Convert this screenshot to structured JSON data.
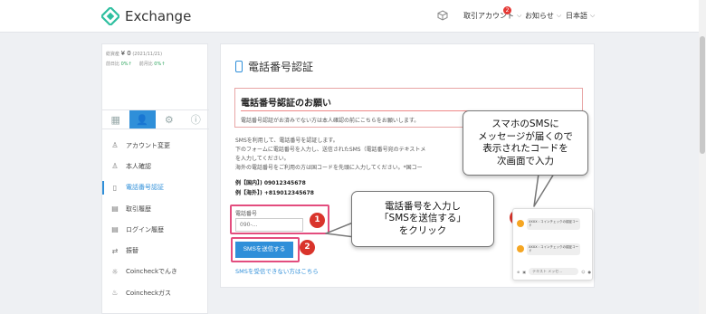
{
  "header": {
    "brand": "Exchange",
    "brand_color": "#2fbfa0",
    "nav": [
      {
        "label": "取引アカウント",
        "badge": "2"
      },
      {
        "label": "お知らせ"
      },
      {
        "label": "日本語"
      }
    ]
  },
  "sidebar": {
    "balance_label": "総資産",
    "balance_value": "¥ 0",
    "balance_date": "(2021/11/21)",
    "prev_day_label": "前日比",
    "prev_day_value": "0%↑",
    "prev_month_label": "前月比",
    "prev_month_value": "0%↑",
    "tabs": [
      {
        "icon": "grid-icon"
      },
      {
        "icon": "user-icon"
      },
      {
        "icon": "gear-icon"
      },
      {
        "icon": "help-icon"
      }
    ],
    "items": [
      {
        "label": "アカウント変更",
        "icon": "user-edit-icon"
      },
      {
        "label": "本人確認",
        "icon": "id-icon"
      },
      {
        "label": "電話番号認証",
        "icon": "phone-icon",
        "active": true
      },
      {
        "label": "取引履歴",
        "icon": "history-icon"
      },
      {
        "label": "ログイン履歴",
        "icon": "login-history-icon"
      },
      {
        "label": "振替",
        "icon": "transfer-icon"
      },
      {
        "label": "Coincheckでんき",
        "icon": "bulb-icon"
      },
      {
        "label": "Coincheckガス",
        "icon": "gas-icon"
      }
    ]
  },
  "main": {
    "title": "電話番号認証",
    "notice_title": "電話番号認証のお願い",
    "notice_text": "電話番号認証がお済みでない方は本人確認の前にこちらをお願いします。",
    "body_lines": [
      "SMSを利用して、電話番号を認証します。",
      "下のフォームに電話番号を入力し、送信されたSMS（電話番号宛のテキストメ",
      "を入力してください。",
      "海外の電話番号をご利用の方は国コードを先頭に入力してください。*国コー"
    ],
    "example_domestic": "例【国内】) 09012345678",
    "example_overseas": "例【海外】) +819012345678",
    "field_label": "電話番号",
    "field_placeholder": "090-...",
    "send_button": "SMSを送信する",
    "sms_link": "SMSを受信できない方はこちら"
  },
  "callouts": {
    "step1": "1",
    "step2": "2",
    "step3": "3",
    "bubble_left": [
      "電話番号を入力し",
      "「SMSを送信する」",
      "をクリック"
    ],
    "bubble_right": [
      "スマホのSMSに",
      "メッセージが届くので",
      "表示されたコードを",
      "次画面で入力"
    ],
    "accent": "#d9342b",
    "highlight": "#e34d7e"
  },
  "phone_preview": {
    "msg1": "XXXX : コインチェックの認証コード",
    "msg2": "XXXX : コインチェックの認証コード",
    "input_placeholder": "テキスト メッセ..."
  }
}
